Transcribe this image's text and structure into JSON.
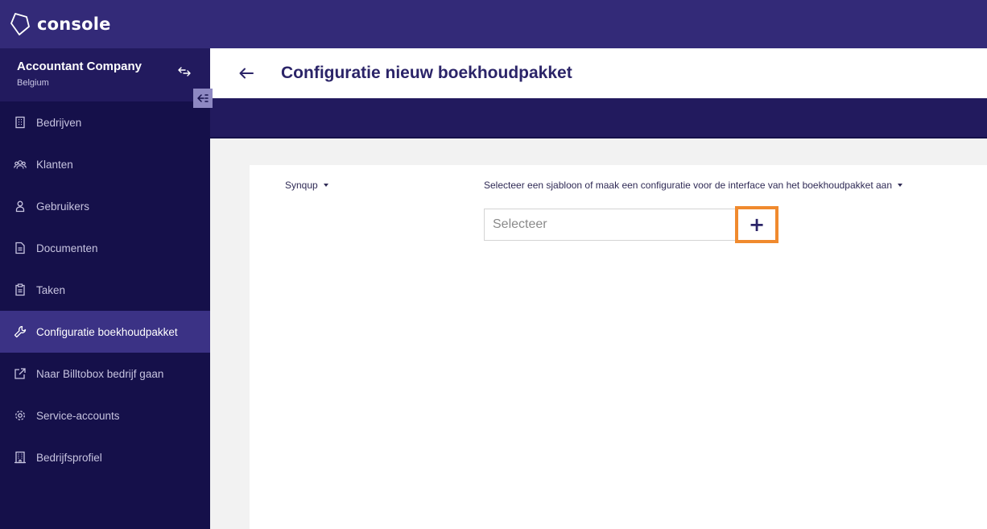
{
  "app": {
    "logo_text": "console"
  },
  "company": {
    "name": "Accountant Company",
    "country": "Belgium"
  },
  "sidebar": {
    "items": [
      {
        "label": "Bedrijven",
        "icon": "building-icon"
      },
      {
        "label": "Klanten",
        "icon": "users-icon"
      },
      {
        "label": "Gebruikers",
        "icon": "user-icon"
      },
      {
        "label": "Documenten",
        "icon": "document-icon"
      },
      {
        "label": "Taken",
        "icon": "clipboard-icon"
      },
      {
        "label": "Configuratie boekhoudpakket",
        "icon": "wrench-icon",
        "active": true
      },
      {
        "label": "Naar Billtobox bedrijf gaan",
        "icon": "external-link-icon"
      },
      {
        "label": "Service-accounts",
        "icon": "gear-icon"
      },
      {
        "label": "Bedrijfsprofiel",
        "icon": "office-building-icon"
      }
    ]
  },
  "header": {
    "title": "Configuratie nieuw boekhoudpakket"
  },
  "form": {
    "package_dropdown": "Synqup",
    "template_dropdown": "Selecteer een sjabloon of maak een configuratie voor de interface van het boekhoudpakket aan",
    "select_placeholder": "Selecteer",
    "add_label": "+"
  },
  "colors": {
    "topbar": "#332a78",
    "sidebar": "#15104a",
    "active_item": "#3b3285",
    "highlight": "#f08a2e",
    "title": "#2b2468"
  }
}
